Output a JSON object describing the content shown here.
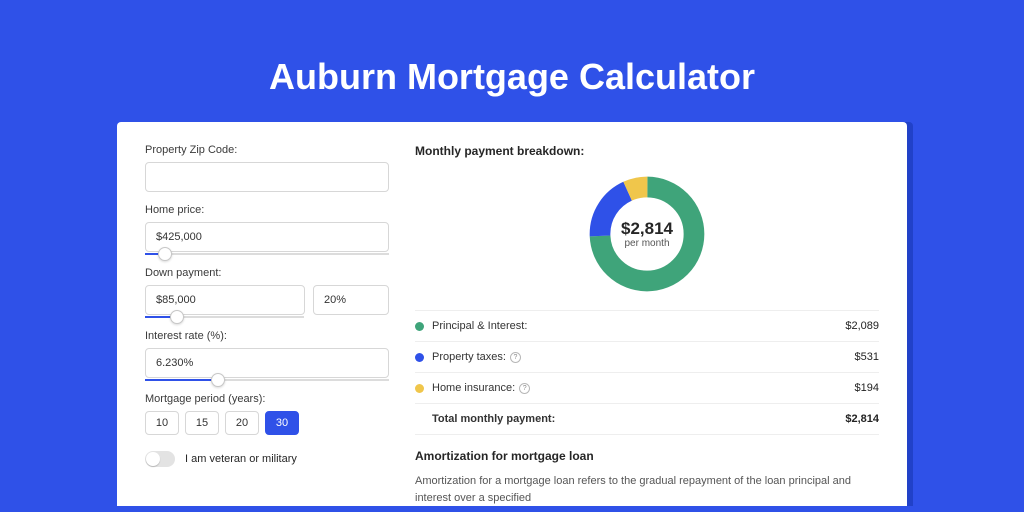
{
  "page": {
    "title": "Auburn Mortgage Calculator"
  },
  "form": {
    "zip": {
      "label": "Property Zip Code:",
      "value": ""
    },
    "home_price": {
      "label": "Home price:",
      "value": "$425,000",
      "slider_pct": 8
    },
    "down_payment": {
      "label": "Down payment:",
      "value": "$85,000",
      "pct_value": "20%",
      "slider_pct": 20
    },
    "interest": {
      "label": "Interest rate (%):",
      "value": "6.230%",
      "slider_pct": 30
    },
    "period": {
      "label": "Mortgage period (years):",
      "options": [
        "10",
        "15",
        "20",
        "30"
      ],
      "selected": "30"
    },
    "veteran": {
      "label": "I am veteran or military",
      "checked": false
    }
  },
  "breakdown": {
    "title": "Monthly payment breakdown:",
    "center_amount": "$2,814",
    "center_caption": "per month",
    "items": [
      {
        "key": "principal_interest",
        "label": "Principal & Interest:",
        "value": "$2,089",
        "color": "#3fa47a",
        "info": false
      },
      {
        "key": "property_taxes",
        "label": "Property taxes:",
        "value": "$531",
        "color": "#2f51e8",
        "info": true
      },
      {
        "key": "home_insurance",
        "label": "Home insurance:",
        "value": "$194",
        "color": "#f0c64b",
        "info": true
      }
    ],
    "total": {
      "label": "Total monthly payment:",
      "value": "$2,814"
    }
  },
  "chart_data": {
    "type": "pie",
    "title": "Monthly payment breakdown",
    "unit": "$",
    "total": 2814,
    "series": [
      {
        "name": "Principal & Interest",
        "value": 2089,
        "color": "#3fa47a"
      },
      {
        "name": "Property taxes",
        "value": 531,
        "color": "#2f51e8"
      },
      {
        "name": "Home insurance",
        "value": 194,
        "color": "#f0c64b"
      }
    ]
  },
  "amortization": {
    "title": "Amortization for mortgage loan",
    "text": "Amortization for a mortgage loan refers to the gradual repayment of the loan principal and interest over a specified"
  }
}
